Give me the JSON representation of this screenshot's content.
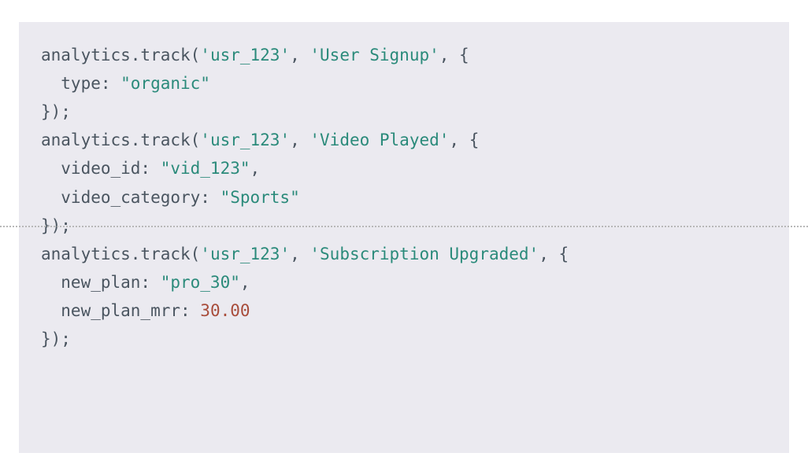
{
  "code": {
    "lines": [
      {
        "tokens": [
          {
            "t": "analytics.track(",
            "c": "default"
          },
          {
            "t": "'usr_123'",
            "c": "string"
          },
          {
            "t": ", ",
            "c": "default"
          },
          {
            "t": "'User Signup'",
            "c": "string"
          },
          {
            "t": ", {",
            "c": "default"
          }
        ],
        "indent": 0
      },
      {
        "tokens": [
          {
            "t": "type: ",
            "c": "default"
          },
          {
            "t": "\"organic\"",
            "c": "string"
          }
        ],
        "indent": 1
      },
      {
        "tokens": [
          {
            "t": "});",
            "c": "default"
          }
        ],
        "indent": 0
      },
      {
        "tokens": [
          {
            "t": "analytics.track(",
            "c": "default"
          },
          {
            "t": "'usr_123'",
            "c": "string"
          },
          {
            "t": ", ",
            "c": "default"
          },
          {
            "t": "'Video Played'",
            "c": "string"
          },
          {
            "t": ", {",
            "c": "default"
          }
        ],
        "indent": 0
      },
      {
        "tokens": [
          {
            "t": "video_id: ",
            "c": "default"
          },
          {
            "t": "\"vid_123\"",
            "c": "string"
          },
          {
            "t": ",",
            "c": "default"
          }
        ],
        "indent": 1
      },
      {
        "tokens": [
          {
            "t": "video_category: ",
            "c": "default"
          },
          {
            "t": "\"Sports\"",
            "c": "string"
          }
        ],
        "indent": 1
      },
      {
        "tokens": [
          {
            "t": "});",
            "c": "default"
          }
        ],
        "indent": 0
      },
      {
        "tokens": [
          {
            "t": "analytics.track(",
            "c": "default"
          },
          {
            "t": "'usr_123'",
            "c": "string"
          },
          {
            "t": ", ",
            "c": "default"
          },
          {
            "t": "'Subscription Upgraded'",
            "c": "string"
          },
          {
            "t": ", {",
            "c": "default"
          }
        ],
        "indent": 0
      },
      {
        "tokens": [
          {
            "t": "new_plan: ",
            "c": "default"
          },
          {
            "t": "\"pro_30\"",
            "c": "string"
          },
          {
            "t": ",",
            "c": "default"
          }
        ],
        "indent": 1
      },
      {
        "tokens": [
          {
            "t": "new_plan_mrr: ",
            "c": "default"
          },
          {
            "t": "30.00",
            "c": "number"
          }
        ],
        "indent": 1
      },
      {
        "tokens": [
          {
            "t": "});",
            "c": "default"
          }
        ],
        "indent": 0
      }
    ],
    "divider_after_line_index": 5
  }
}
